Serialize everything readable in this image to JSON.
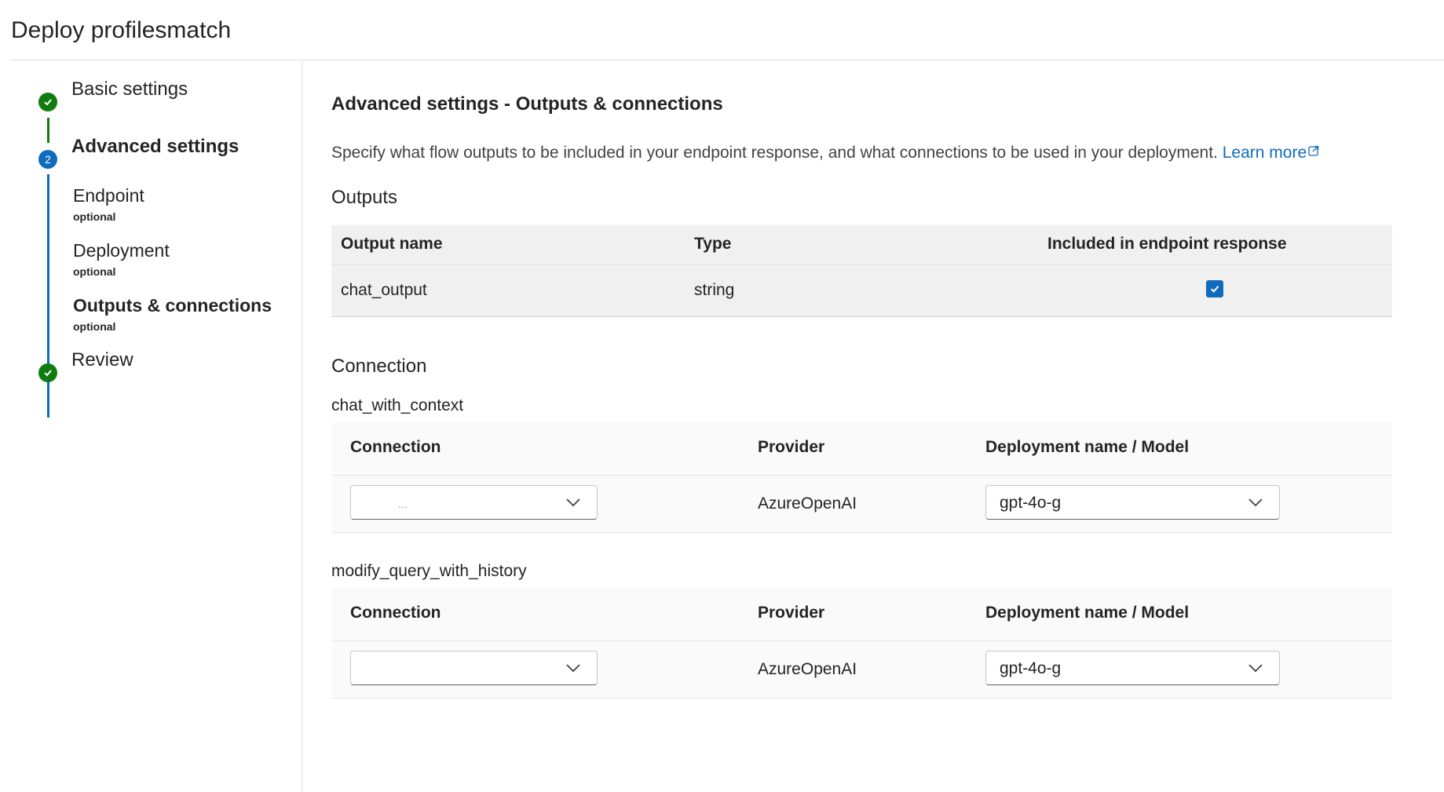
{
  "header": {
    "title": "Deploy profilesmatch"
  },
  "sidebar": {
    "steps": [
      {
        "label": "Basic settings",
        "status": "done"
      },
      {
        "label": "Advanced settings",
        "status": "current",
        "number": "2"
      },
      {
        "label": "Review",
        "status": "done"
      }
    ],
    "substeps": [
      {
        "label": "Endpoint",
        "hint": "optional"
      },
      {
        "label": "Deployment",
        "hint": "optional"
      },
      {
        "label": "Outputs & connections",
        "hint": "optional"
      }
    ]
  },
  "main": {
    "title": "Advanced settings - Outputs & connections",
    "description": "Specify what flow outputs to be included in your endpoint response, and what connections to be used in your deployment.",
    "learn_more": "Learn more",
    "outputs": {
      "heading": "Outputs",
      "columns": [
        "Output name",
        "Type",
        "Included in endpoint response"
      ],
      "rows": [
        {
          "name": "chat_output",
          "type": "string",
          "included": true
        }
      ]
    },
    "connection": {
      "heading": "Connection",
      "blocks": [
        {
          "node": "chat_with_context",
          "columns": [
            "Connection",
            "Provider",
            "Deployment name / Model"
          ],
          "connection_value": "...",
          "provider": "AzureOpenAI",
          "model": "gpt-4o-g"
        },
        {
          "node": "modify_query_with_history",
          "columns": [
            "Connection",
            "Provider",
            "Deployment name / Model"
          ],
          "connection_value": "",
          "provider": "AzureOpenAI",
          "model": "gpt-4o-g"
        }
      ]
    }
  },
  "colors": {
    "accent": "#0f6cbd",
    "success": "#107c10"
  }
}
